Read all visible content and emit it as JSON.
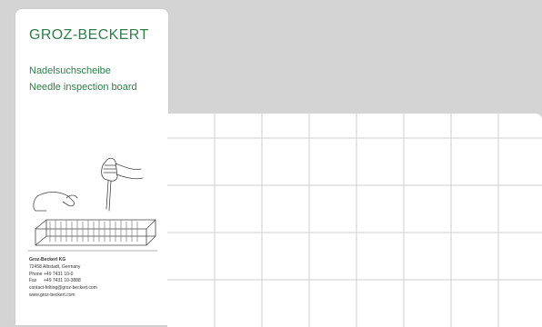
{
  "card": {
    "brand": "GROZ-BECKERT",
    "title_de": "Nadelsuchscheibe",
    "title_en": "Needle inspection board",
    "contact": {
      "company": "Groz-Beckert KG",
      "address": "72458 Albstadt, Germany",
      "phone_label": "Phone",
      "phone": "+49 7431 10-0",
      "fax_label": "Fax",
      "fax": "+49 7431 10-3888",
      "email": "contact-felting@groz-beckert.com",
      "web": "www.groz-beckert.com"
    }
  },
  "board": {
    "columns": 8,
    "rows": 4,
    "grid_color": "#cfcfcf"
  },
  "colors": {
    "background": "#d4d4d4",
    "brand_green": "#2f7d4a"
  }
}
